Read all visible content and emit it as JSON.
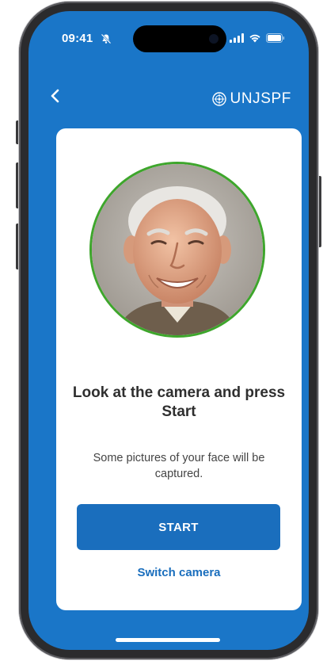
{
  "status_bar": {
    "time": "09:41",
    "icons": [
      "bell-off-icon",
      "signal-icon",
      "wifi-icon",
      "battery-icon"
    ]
  },
  "header": {
    "back_icon": "chevron-left-icon",
    "brand_emblem": "un-emblem-icon",
    "brand_name": "UNJSPF"
  },
  "card": {
    "title": "Look at the camera and press Start",
    "subtitle": "Some pictures of your face will be captured.",
    "start_label": "START",
    "switch_camera_label": "Switch camera"
  },
  "colors": {
    "app_blue": "#1a76c8",
    "button_blue": "#1a6ebd",
    "avatar_ring": "#3ea62c",
    "card_bg": "#ffffff"
  }
}
